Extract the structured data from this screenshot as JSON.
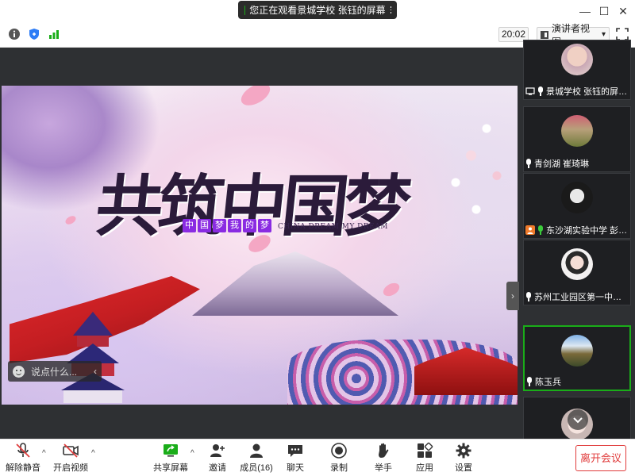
{
  "window": {
    "share_banner": "您正在观看景城学校  张钰的屏幕",
    "minimize_label": "—",
    "maximize_label": "☐",
    "close_label": "✕"
  },
  "toolbar": {
    "time": "20:02",
    "view_mode": "演讲者视图",
    "view_caret": "▾"
  },
  "slide": {
    "title": "共筑中国梦",
    "subtitle_boxes": [
      "中",
      "国",
      "梦",
      "我",
      "的",
      "梦"
    ],
    "subtitle_en": "CHINA DREAM  MY DREAM"
  },
  "chat": {
    "placeholder": "说点什么...",
    "collapse": "‹"
  },
  "side_collapse": "›",
  "participants": [
    {
      "name": "景城学校  张钰的屏幕...",
      "mic": "white",
      "prefix_icon": "screen-share"
    },
    {
      "name": "青剑湖  崔琦琳",
      "mic": "white",
      "prefix_icon": "none"
    },
    {
      "name": "东沙湖实验中学  彭雪...",
      "mic": "green",
      "prefix_icon": "host"
    },
    {
      "name": "苏州工业园区第一中学李...",
      "mic": "white",
      "prefix_icon": "none"
    },
    {
      "name": "陈玉兵",
      "mic": "white",
      "prefix_icon": "none",
      "active": true
    },
    {
      "name": "",
      "mic": "",
      "prefix_icon": "none"
    }
  ],
  "bottom": {
    "mute": "解除静音",
    "video": "开启视频",
    "share": "共享屏幕",
    "invite": "邀请",
    "members": "成员(16)",
    "chat": "聊天",
    "record": "录制",
    "raise_hand": "举手",
    "apps": "应用",
    "settings": "设置",
    "leave": "离开会议",
    "caret": "^"
  },
  "colors": {
    "accent_green": "#1aad19",
    "leave_red": "#e03b3b",
    "panel_dark": "#2e3033"
  }
}
